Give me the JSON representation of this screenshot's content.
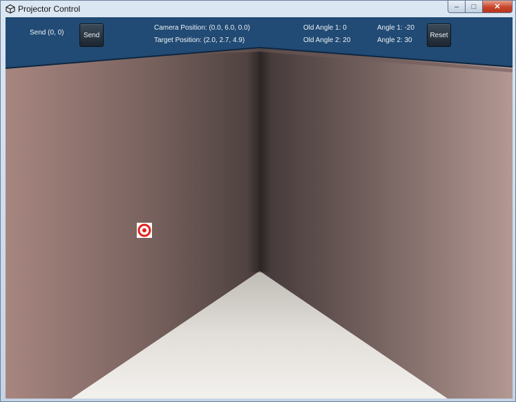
{
  "window": {
    "title": "Projector Control"
  },
  "controls": {
    "send_status": "Send (0, 0)",
    "send_label": "Send",
    "reset_label": "Reset",
    "camera_position": "Camera Position: (0.0, 6.0, 0.0)",
    "target_position": "Target Position: (2.0, 2.7, 4.9)",
    "old_angle_1": "Old Angle 1: 0",
    "old_angle_2": "Old Angle 2: 20",
    "angle_1": "Angle 1: -20",
    "angle_2": "Angle 2: 30"
  },
  "colors": {
    "panel": "#214a74",
    "target": "#e2201a"
  },
  "icons": {
    "app": "unity-icon",
    "target": "target-icon"
  }
}
